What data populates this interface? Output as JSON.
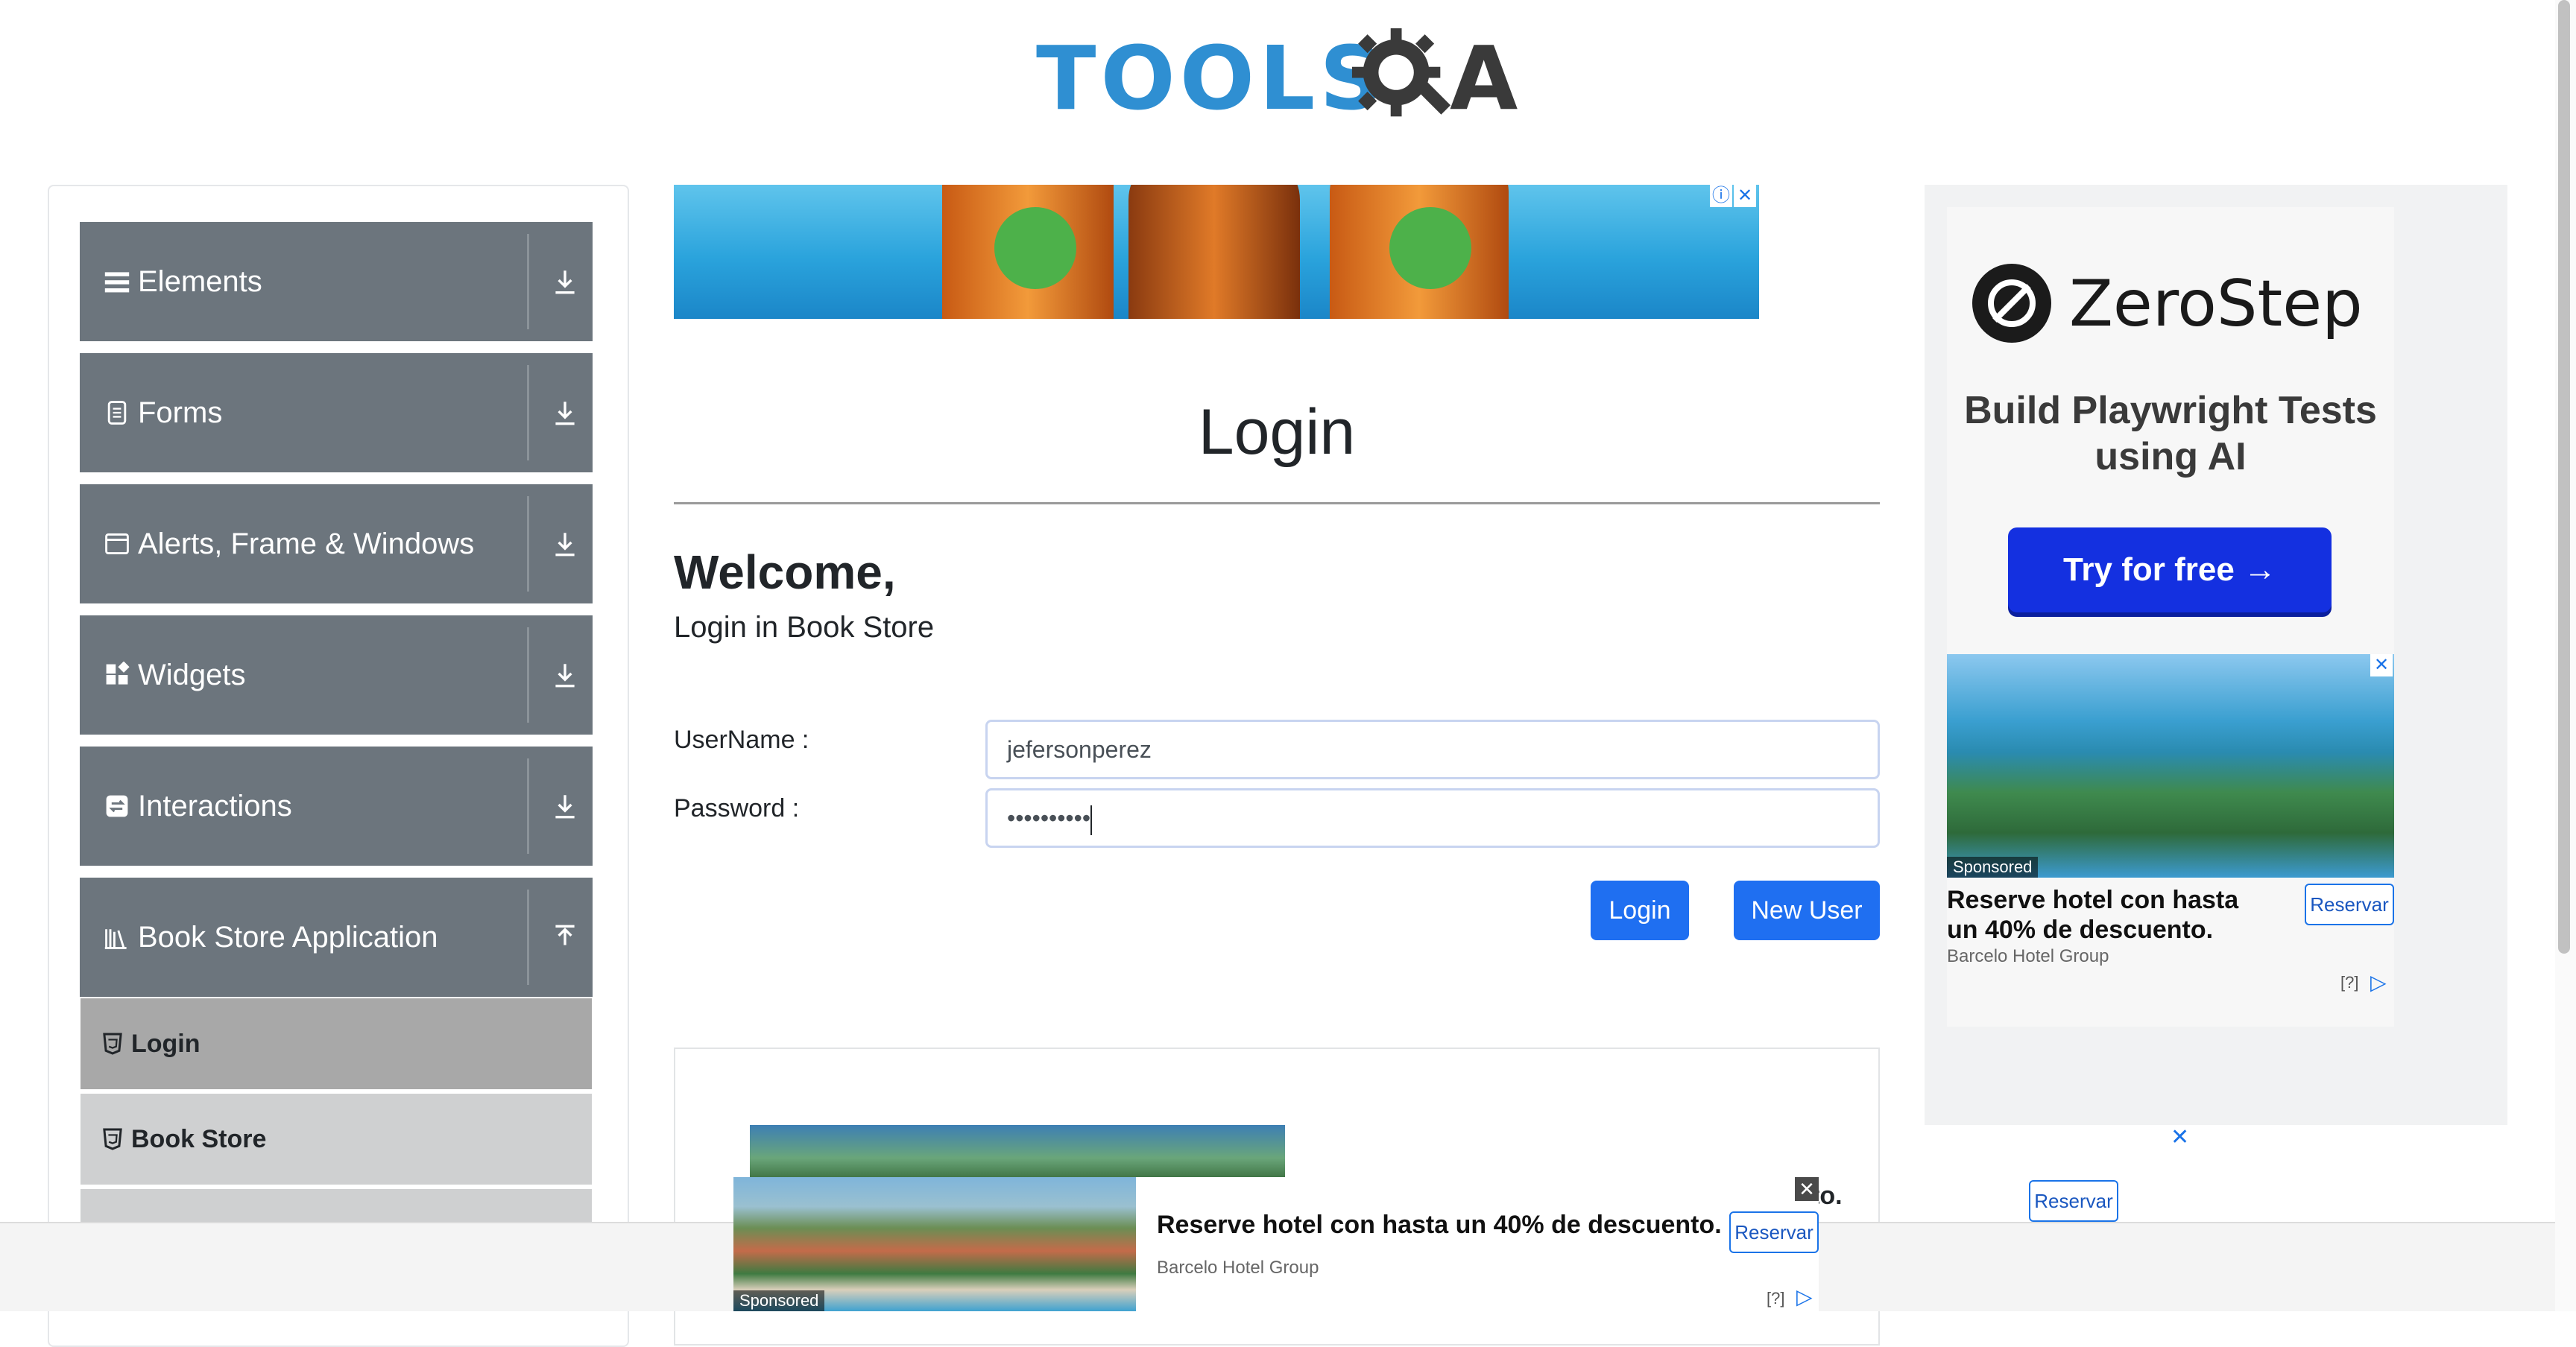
{
  "header": {
    "logo_text": "TOOLSQA"
  },
  "sidebar": {
    "groups": [
      {
        "label": "Elements",
        "icon": "menu-icon"
      },
      {
        "label": "Forms",
        "icon": "form-icon"
      },
      {
        "label": "Alerts, Frame & Windows",
        "icon": "window-icon"
      },
      {
        "label": "Widgets",
        "icon": "widgets-icon"
      },
      {
        "label": "Interactions",
        "icon": "interactions-icon"
      },
      {
        "label": "Book Store Application",
        "icon": "books-icon"
      }
    ],
    "book_store_items": [
      {
        "label": "Login",
        "active": true
      },
      {
        "label": "Book Store",
        "active": false
      }
    ]
  },
  "main": {
    "page_title": "Login",
    "welcome": "Welcome,",
    "subtitle": "Login in Book Store",
    "username_label": "UserName :",
    "username_value": "jefersonperez",
    "password_label": "Password :",
    "password_value": "••••••••••",
    "login_button": "Login",
    "new_user_button": "New User"
  },
  "right_ad": {
    "brand": "ZeroStep",
    "tagline": "Build Playwright Tests using AI",
    "cta": "Try for free →",
    "sponsored": "Sponsored",
    "hotel_title": "Reserve hotel con hasta un 40% de descuento.",
    "hotel_company": "Barcelo Hotel Group",
    "reserve": "Reservar",
    "info": "[?]"
  },
  "inline_ad": {
    "text_fragment": "to.",
    "reserve": "Reservar"
  },
  "bottom_ad": {
    "sponsored": "Sponsored",
    "title": "Reserve hotel con hasta un 40% de descuento.",
    "company": "Barcelo Hotel Group",
    "reserve": "Reservar",
    "info": "[?]"
  },
  "colors": {
    "accent": "#1f6ff1",
    "sidebar_group": "#6c757d",
    "logo_blue": "#2f8fd2"
  }
}
